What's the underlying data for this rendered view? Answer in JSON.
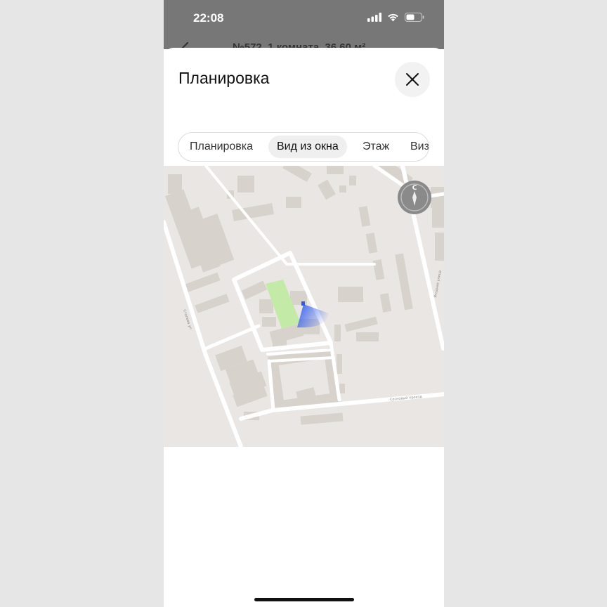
{
  "status_bar": {
    "time": "22:08"
  },
  "underlying_header": {
    "title": "№572, 1 комната, 36,60 м²"
  },
  "sheet": {
    "title": "Планировка"
  },
  "tabs": [
    {
      "label": "Планировка",
      "active": false
    },
    {
      "label": "Вид из окна",
      "active": true
    },
    {
      "label": "Этаж",
      "active": false
    },
    {
      "label": "Виз",
      "active": false
    }
  ],
  "map": {
    "compass_letter": "С",
    "colors": {
      "background": "#eae6e3",
      "building": "#d8d2cd",
      "road": "#ffffff",
      "park": "#c4eaa8",
      "view_cone": "#2d5bf0"
    },
    "labels": [
      {
        "name": "road-label-left",
        "text": "Сталева ул"
      },
      {
        "name": "road-label-bottom",
        "text": "Сосновый проезд"
      },
      {
        "name": "road-label-right",
        "text": "Ягодная улица"
      }
    ]
  }
}
